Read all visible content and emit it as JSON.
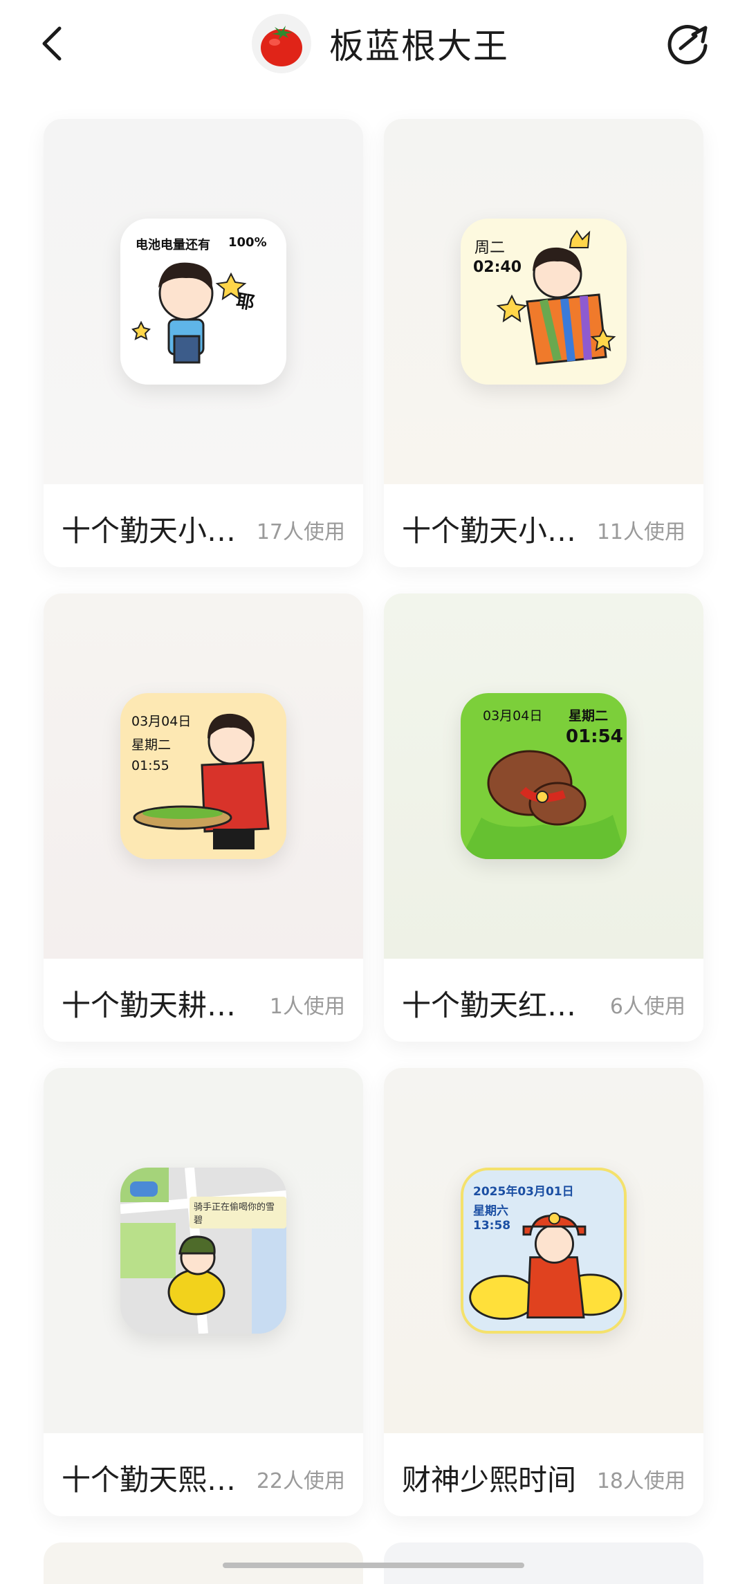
{
  "header": {
    "title": "板蓝根大王"
  },
  "cards": [
    {
      "name": "十个勤天小…",
      "uses": "17人使用",
      "thumb": {
        "line1": "电池电量还有",
        "line2": "100%",
        "line3": "耶"
      }
    },
    {
      "name": "十个勤天小…",
      "uses": "11人使用",
      "thumb": {
        "line1": "周二",
        "line2": "02:40"
      }
    },
    {
      "name": "十个勤天耕…",
      "uses": "1人使用",
      "thumb": {
        "line1": "03月04日",
        "line2": "星期二",
        "line3": "01:55"
      }
    },
    {
      "name": "十个勤天红…",
      "uses": "6人使用",
      "thumb": {
        "line1": "03月04日",
        "line2": "星期二",
        "line3": "01:54"
      }
    },
    {
      "name": "十个勤天熙…",
      "uses": "22人使用",
      "thumb": {
        "line1": "骑手正在偷喝你的雪碧"
      }
    },
    {
      "name": "财神少熙时间",
      "uses": "18人使用",
      "thumb": {
        "line1": "2025年03月01日",
        "line2": "星期六",
        "line3": "13:58"
      }
    }
  ]
}
